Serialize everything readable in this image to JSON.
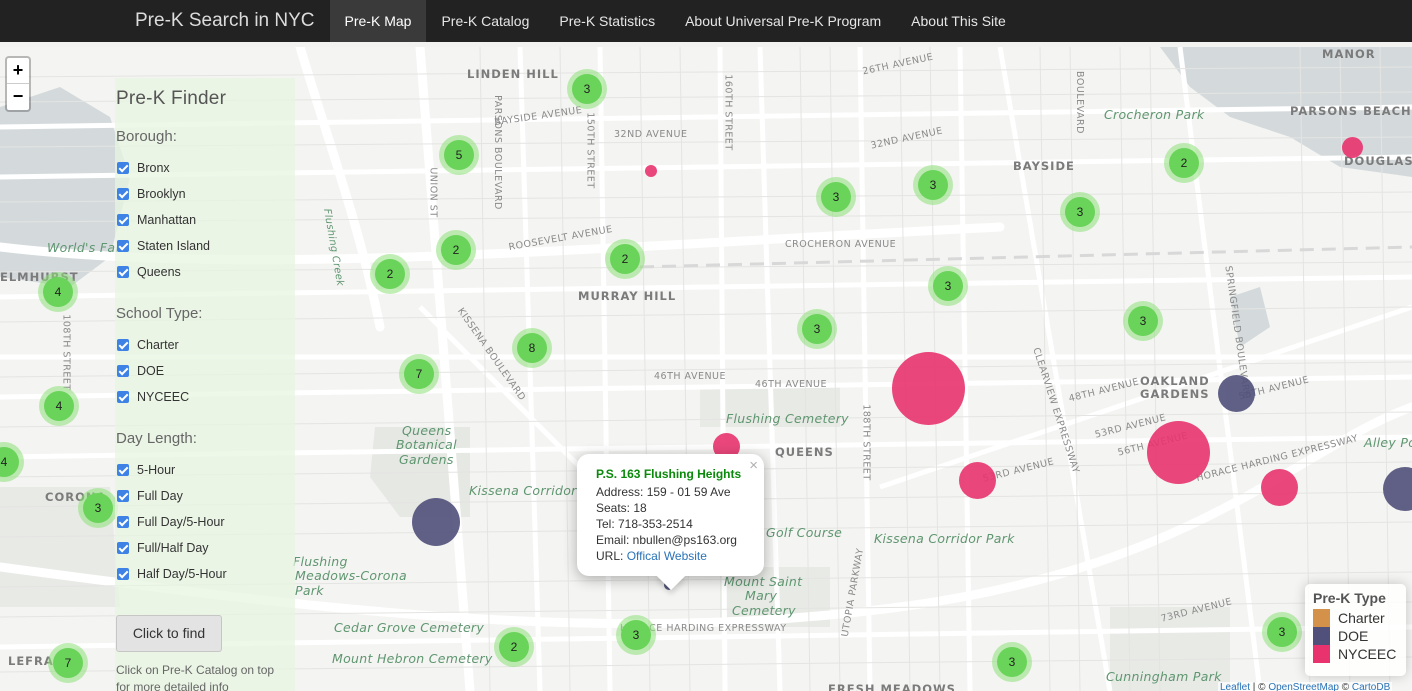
{
  "navbar": {
    "brand": "Pre-K Search in NYC",
    "items": [
      {
        "label": "Pre-K Map",
        "active": true
      },
      {
        "label": "Pre-K Catalog",
        "active": false
      },
      {
        "label": "Pre-K Statistics",
        "active": false
      },
      {
        "label": "About Universal Pre-K Program",
        "active": false
      },
      {
        "label": "About This Site",
        "active": false
      }
    ]
  },
  "map": {
    "zoom_in": "+",
    "zoom_out": "−",
    "labels": {
      "linden_hill": "LINDEN HILL",
      "murray_hill": "MURRAY HILL",
      "bayside": "BAYSIDE",
      "oakland_gardens": "OAKLAND GARDENS",
      "queens": "QUEENS",
      "corona": "CORONA",
      "elmhurst": "ELMHURST",
      "lefrak": "LEFRAK",
      "manor": "MANOR",
      "parsons_beach": "PARSONS BEACH",
      "douglast": "DOUGLAST",
      "fresh_meadows": "FRESH MEADOWS",
      "crocheron_park": "Crocheron Park",
      "flushing_cemetery": "Flushing Cemetery",
      "qbg_1": "Queens",
      "qbg_2": "Botanical",
      "qbg_3": "Gardens",
      "kissena_corridor_w": "Kissena Corridor P",
      "kissena_corridor_e": "Kissena Corridor Park",
      "golf_course": "Golf Course",
      "mount_saint_mary_1": "Mount Saint",
      "mount_saint_mary_2": "Mary",
      "mount_saint_mary_3": "Cemetery",
      "cedar_grove": "Cedar Grove Cemetery",
      "mount_hebron": "Mount Hebron Cemetery",
      "cunningham_park": "Cunningham Park",
      "alley_pond": "Alley Po",
      "worlds_fair": "World's Fai",
      "flushing_creek": "Flushing Creek",
      "flushing_meadows_1": "Flushing",
      "flushing_meadows_2": "Meadows-Corona",
      "flushing_meadows_3": "Park",
      "st_26th_ave": "26TH AVENUE",
      "st_32nd_ave": "32ND AVENUE",
      "st_bayside_ave": "BAYSIDE AVENUE",
      "st_roosevelt_ave": "ROOSEVELT AVENUE",
      "st_crocheron_ave": "CROCHERON AVENUE",
      "st_46th_ave": "46TH AVENUE",
      "st_48th_ave": "48TH AVENUE",
      "st_53rd_ave": "53RD AVENUE",
      "st_56th_ave": "56TH AVENUE",
      "st_73rd_ave": "73RD AVENUE",
      "st_horace": "HORACE HARDING EXPRESSWAY",
      "st_kissena_blvd": "KISSENA BOULEVARD",
      "st_150th": "150TH STREET",
      "st_160th": "160TH STREET",
      "st_188th": "188TH STREET",
      "st_utopia": "UTOPIA PARKWAY",
      "st_clearview": "CLEARVIEW EXPRESSWAY",
      "st_springfield": "SPRINGFIELD BOULEVARD",
      "st_union": "UNION ST",
      "st_parsons": "PARSONS BOULEVARD",
      "st_boulevard": "BOULEVARD",
      "st_108th": "108TH STREET"
    },
    "clusters": [
      "3",
      "5",
      "2",
      "2",
      "2",
      "3",
      "3",
      "3",
      "2",
      "4",
      "3",
      "3",
      "8",
      "3",
      "7",
      "4",
      "4",
      "3",
      "3",
      "2",
      "3",
      "3",
      "7"
    ],
    "colors": {
      "charter": "#d4914a",
      "doe": "#50507a",
      "nyceec": "#e8336e",
      "cluster": "#6ad35a"
    }
  },
  "finder": {
    "title": "Pre-K Finder",
    "borough_title": "Borough:",
    "boroughs": [
      "Bronx",
      "Brooklyn",
      "Manhattan",
      "Staten Island",
      "Queens"
    ],
    "school_type_title": "School Type:",
    "school_types": [
      "Charter",
      "DOE",
      "NYCEEC"
    ],
    "day_length_title": "Day Length:",
    "day_lengths": [
      "5-Hour",
      "Full Day",
      "Full Day/5-Hour",
      "Full/Half Day",
      "Half Day/5-Hour"
    ],
    "button": "Click to find",
    "note": "Click on Pre-K Catalog on top for more detailed info"
  },
  "popup": {
    "close": "×",
    "title": "P.S. 163 Flushing Heights",
    "address": "Address: 159 - 01 59 Ave",
    "seats": "Seats: 18",
    "tel": "Tel: 718-353-2514",
    "email": "Email: nbullen@ps163.org",
    "url_prefix": "URL: ",
    "url_link": "Offical Website"
  },
  "legend": {
    "title": "Pre-K Type",
    "items": [
      "Charter",
      "DOE",
      "NYCEEC"
    ]
  },
  "attribution": {
    "leaflet": "Leaflet",
    "sep": " | © ",
    "osm": "OpenStreetMap",
    "sep2": " © ",
    "carto": "CartoDB"
  }
}
